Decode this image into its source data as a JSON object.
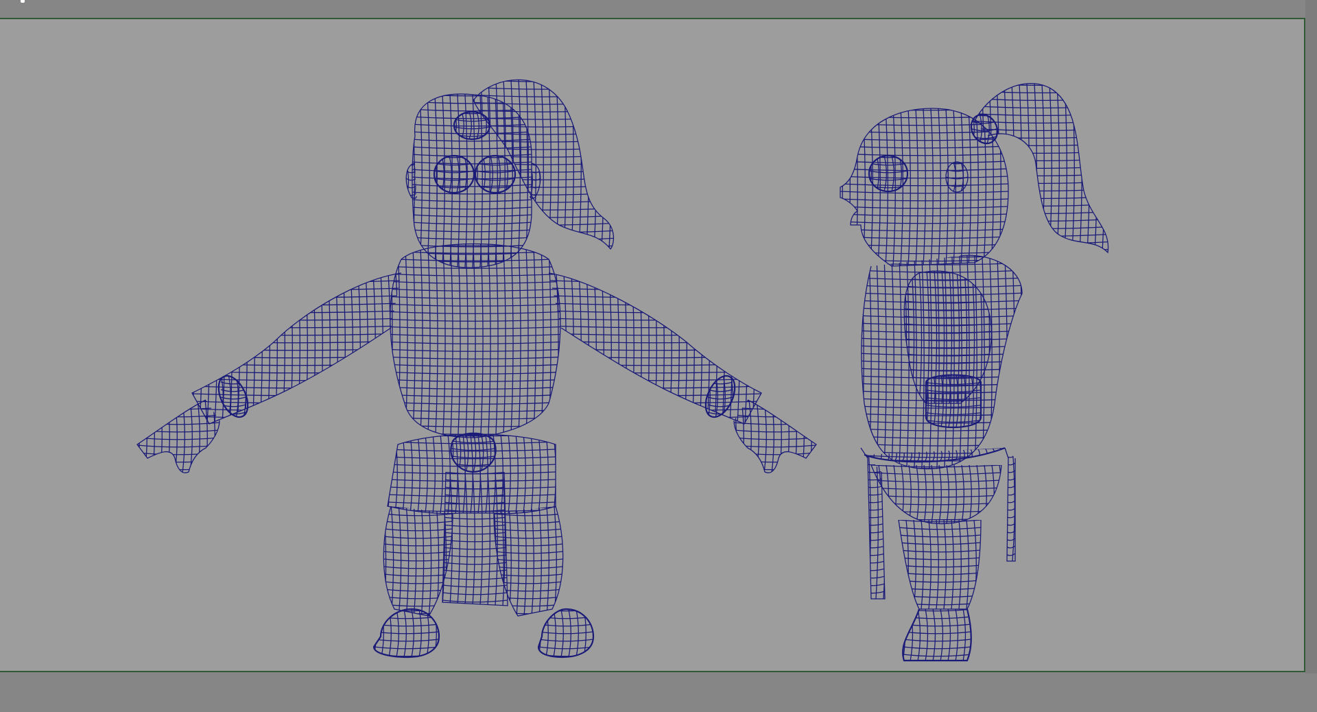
{
  "app": {
    "panel": "perspective-viewport",
    "display_mode": "wireframe"
  },
  "colors": {
    "workspace_bg": "#868686",
    "viewport_bg": "#9d9d9d",
    "viewport_border": "#2f5a34",
    "wire": "#1a1a78"
  },
  "models": [
    {
      "name": "character-front-view"
    },
    {
      "name": "character-side-view"
    }
  ]
}
